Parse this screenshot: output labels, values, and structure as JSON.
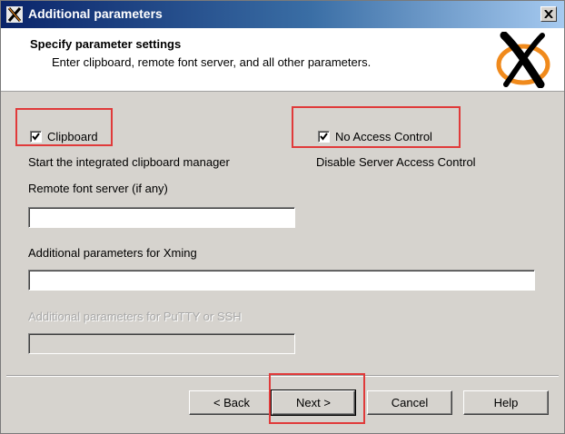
{
  "window": {
    "title": "Additional parameters"
  },
  "header": {
    "title": "Specify parameter settings",
    "subtitle": "Enter clipboard, remote font server, and all other parameters."
  },
  "clipboard": {
    "label": "Clipboard",
    "checked": true,
    "description": "Start the integrated clipboard manager"
  },
  "access_control": {
    "label": "No Access Control",
    "checked": true,
    "description": "Disable Server Access Control"
  },
  "font_server": {
    "label": "Remote font server (if any)",
    "value": ""
  },
  "xming_params": {
    "label": "Additional parameters for Xming",
    "value": ""
  },
  "putty_params": {
    "label": "Additional parameters for PuTTY or SSH",
    "value": "",
    "disabled": true
  },
  "buttons": {
    "back": "< Back",
    "next": "Next >",
    "cancel": "Cancel",
    "help": "Help"
  },
  "colors": {
    "highlight": "#e03a3a",
    "titlebar_start": "#0a246a",
    "logo_orange": "#f08a1c"
  }
}
